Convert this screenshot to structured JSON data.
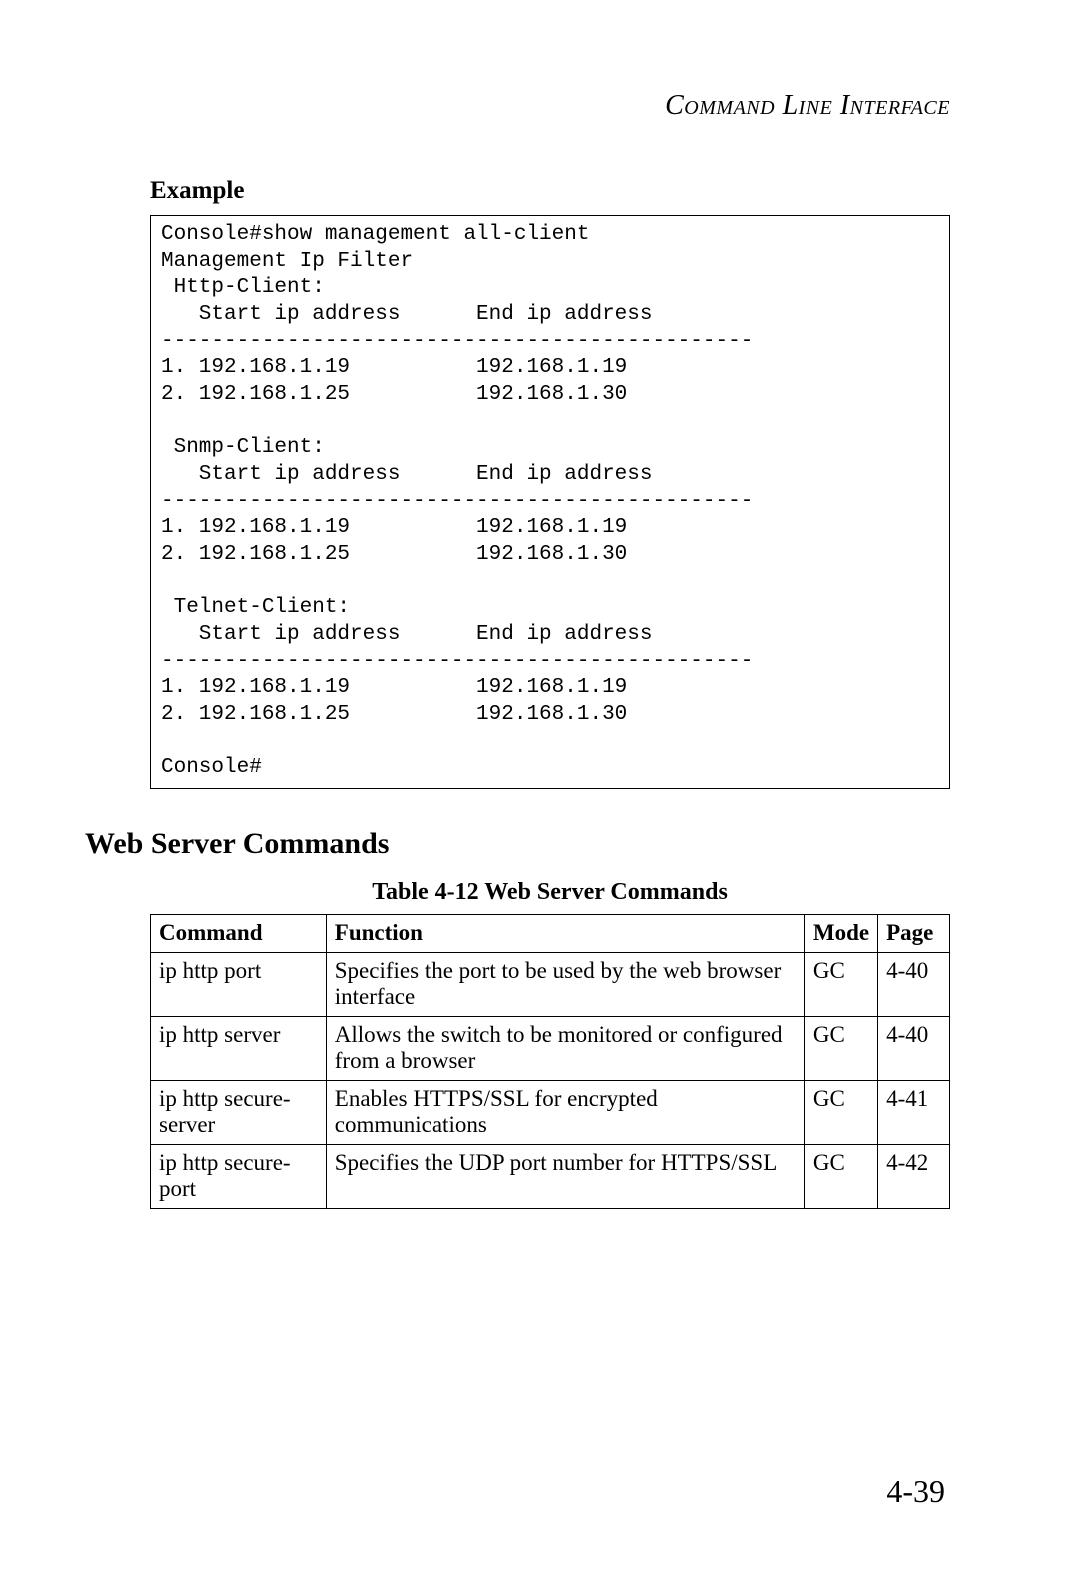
{
  "header": {
    "running_head": "Command Line Interface"
  },
  "example": {
    "label": "Example",
    "console": "Console#show management all-client\nManagement Ip Filter\n Http-Client:\n   Start ip address      End ip address\n-----------------------------------------------\n1. 192.168.1.19          192.168.1.19\n2. 192.168.1.25          192.168.1.30\n\n Snmp-Client:\n   Start ip address      End ip address\n-----------------------------------------------\n1. 192.168.1.19          192.168.1.19\n2. 192.168.1.25          192.168.1.30\n\n Telnet-Client:\n   Start ip address      End ip address\n-----------------------------------------------\n1. 192.168.1.19          192.168.1.19\n2. 192.168.1.25          192.168.1.30\n\nConsole#"
  },
  "section": {
    "heading": "Web Server Commands",
    "table_caption": "Table 4-12   Web Server Commands",
    "columns": {
      "command": "Command",
      "function": "Function",
      "mode": "Mode",
      "page": "Page"
    },
    "rows": [
      {
        "command": "ip http port",
        "function": "Specifies the port to be used by the web browser interface",
        "mode": "GC",
        "page": "4-40"
      },
      {
        "command": "ip http server",
        "function": "Allows the switch to be monitored or configured from a browser",
        "mode": "GC",
        "page": "4-40"
      },
      {
        "command": "ip http secure-server",
        "function": "Enables HTTPS/SSL for encrypted communications",
        "mode": "GC",
        "page": "4-41"
      },
      {
        "command": "ip http secure-port",
        "function": "Specifies the UDP port number for HTTPS/SSL",
        "mode": "GC",
        "page": "4-42"
      }
    ]
  },
  "page_number": "4-39"
}
